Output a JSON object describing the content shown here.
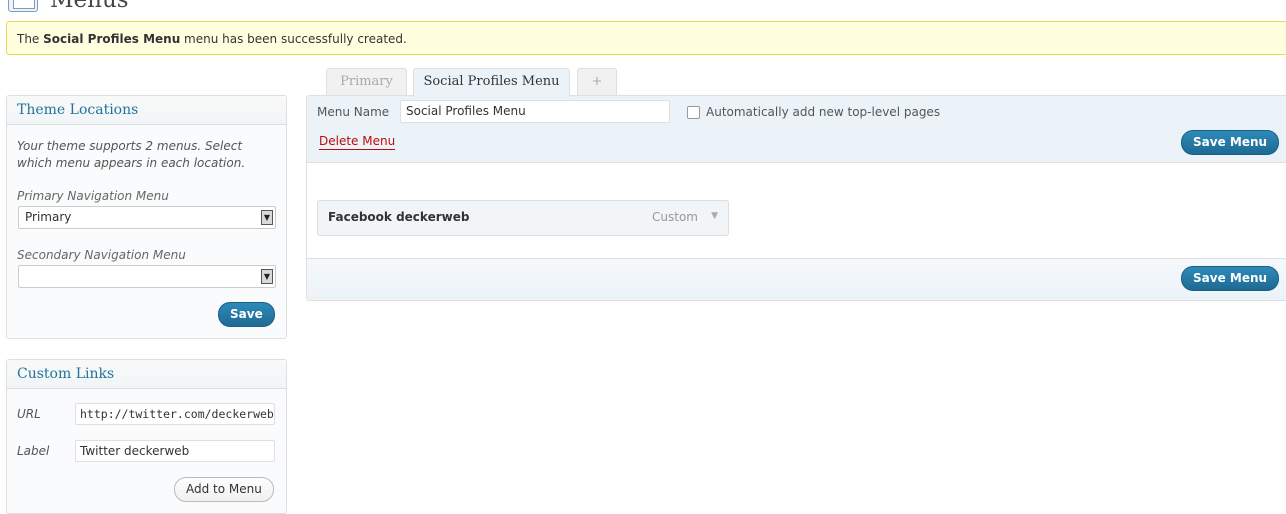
{
  "header": {
    "title": "Menus"
  },
  "notice": {
    "prefix": "The ",
    "menu_name": "Social Profiles Menu",
    "suffix": " menu has been successfully created."
  },
  "tabs": [
    {
      "label": "Primary"
    },
    {
      "label": "Social Profiles Menu"
    },
    {
      "label": "+"
    }
  ],
  "theme_locations": {
    "title": "Theme Locations",
    "description": "Your theme supports 2 menus. Select which menu appears in each location.",
    "primary_label": "Primary Navigation Menu",
    "primary_value": "Primary",
    "secondary_label": "Secondary Navigation Menu",
    "secondary_value": "",
    "save_label": "Save"
  },
  "custom_links": {
    "title": "Custom Links",
    "url_label": "URL",
    "url_value": "http://twitter.com/deckerweb",
    "label_label": "Label",
    "label_value": "Twitter deckerweb",
    "add_label": "Add to Menu"
  },
  "editor": {
    "menu_name_label": "Menu Name",
    "menu_name_value": "Social Profiles Menu",
    "auto_add_label": "Automatically add new top-level pages",
    "delete_label": "Delete Menu",
    "save_label": "Save Menu",
    "items": [
      {
        "title": "Facebook deckerweb",
        "type": "Custom"
      }
    ]
  }
}
